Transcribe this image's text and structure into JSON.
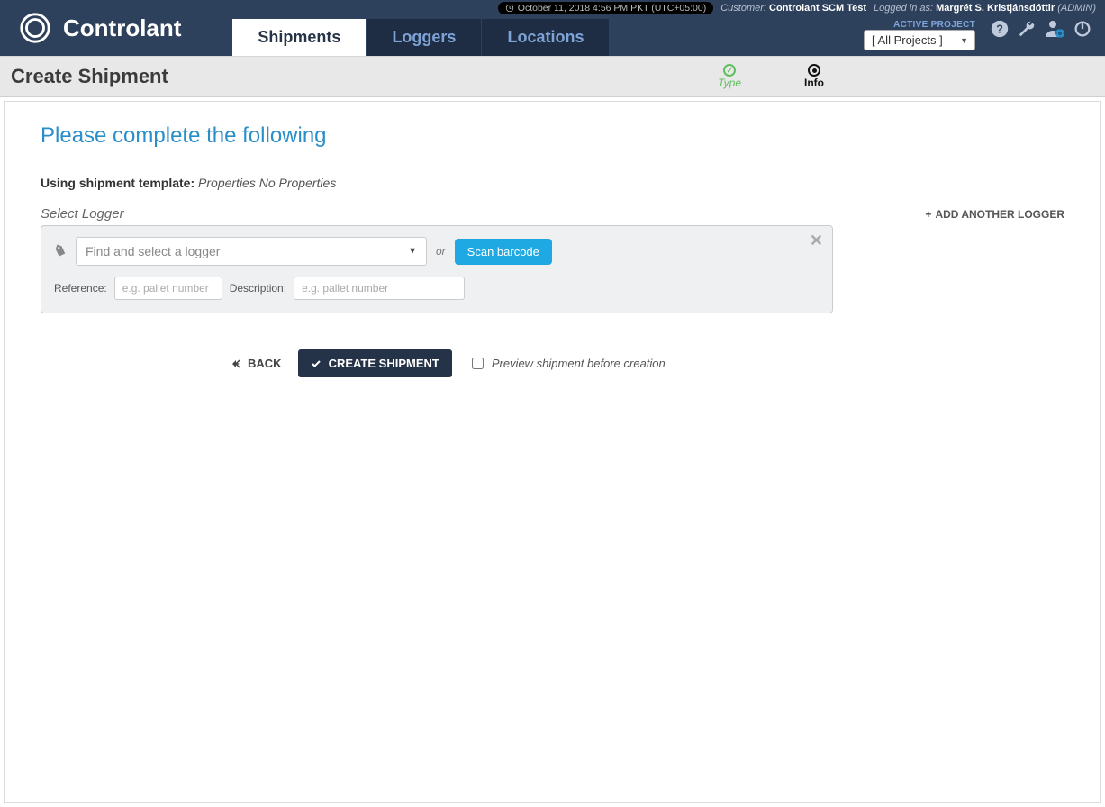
{
  "status": {
    "datetime": "October 11, 2018 4:56 PM PKT (UTC+05:00)",
    "customer_label": "Customer:",
    "customer_value": "Controlant SCM Test",
    "login_label": "Logged in as:",
    "login_user": "Margrét S. Kristjánsdóttir",
    "login_role": "(ADMIN)"
  },
  "brand": {
    "name": "Controlant"
  },
  "tabs": {
    "shipments": "Shipments",
    "loggers": "Loggers",
    "locations": "Locations"
  },
  "project": {
    "label": "ACTIVE PROJECT",
    "selected": "[ All Projects ]"
  },
  "subheader": {
    "title": "Create Shipment",
    "step1": "Type",
    "step2": "Info"
  },
  "main": {
    "heading": "Please complete the following",
    "template_label": "Using shipment template:",
    "template_value": "Properties No Properties",
    "select_logger": "Select Logger",
    "add_another": "ADD ANOTHER LOGGER",
    "combo_placeholder": "Find and select a logger",
    "or": "or",
    "scan": "Scan barcode",
    "reference_label": "Reference:",
    "reference_placeholder": "e.g. pallet number",
    "description_label": "Description:",
    "description_placeholder": "e.g. pallet number",
    "back": "BACK",
    "create": "CREATE SHIPMENT",
    "preview": "Preview shipment before creation"
  }
}
